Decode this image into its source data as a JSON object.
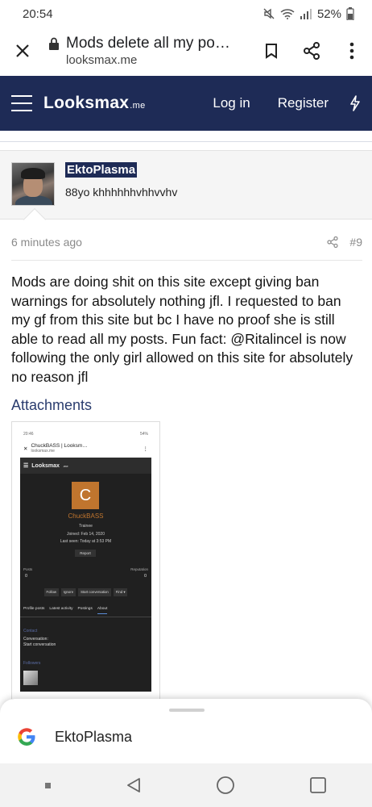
{
  "status_bar": {
    "time": "20:54",
    "battery": "52%"
  },
  "browser": {
    "page_title": "Mods delete all my po…",
    "domain": "looksmax.me"
  },
  "site_header": {
    "logo": "Looksmax",
    "logo_suffix": ".me",
    "login": "Log in",
    "register": "Register"
  },
  "post": {
    "username": "EktoPlasma",
    "user_title": "88yo khhhhhhvhhvvhv",
    "time_ago": "6 minutes ago",
    "post_number": "#9",
    "body": "Mods are doing shit on this site except giving ban warnings for absolutely nothing jfl. I requested to ban my gf from this site but bc I have no proof she is still able to read all my posts. Fun fact: @Ritalincel is now following the only girl allowed on this site for absolutely no reason jfl",
    "attachments_title": "Attachments"
  },
  "attachment": {
    "status_time": "20:46",
    "status_battery": "54%",
    "tab_title": "ChuckBASS | Looksm…",
    "tab_domain": "looksmax.me",
    "logo": "Looksmax",
    "logo_suffix": ".me",
    "avatar_letter": "C",
    "name": "ChuckBASS",
    "rank": "Trainee",
    "joined": "Joined: Feb 14, 2020",
    "last_seen": "Last seen: Today at 3:53 PM",
    "report": "Report",
    "posts_label": "Posts",
    "posts_value": "0",
    "reputation_label": "Reputation",
    "reputation_value": "0",
    "buttons": [
      "Follow",
      "Ignore",
      "Start conversation",
      "Find ▾"
    ],
    "tabs": [
      "Profile posts",
      "Latest activity",
      "Postings",
      "About"
    ],
    "contact_label": "Contact",
    "conversation_label": "Conversation:",
    "start_conversation": "Start conversation",
    "followers_label": "Followers"
  },
  "sheet": {
    "account_name": "EktoPlasma"
  },
  "colors": {
    "header_bg": "#1e2b56",
    "attachments_link": "#2a3c6e"
  }
}
